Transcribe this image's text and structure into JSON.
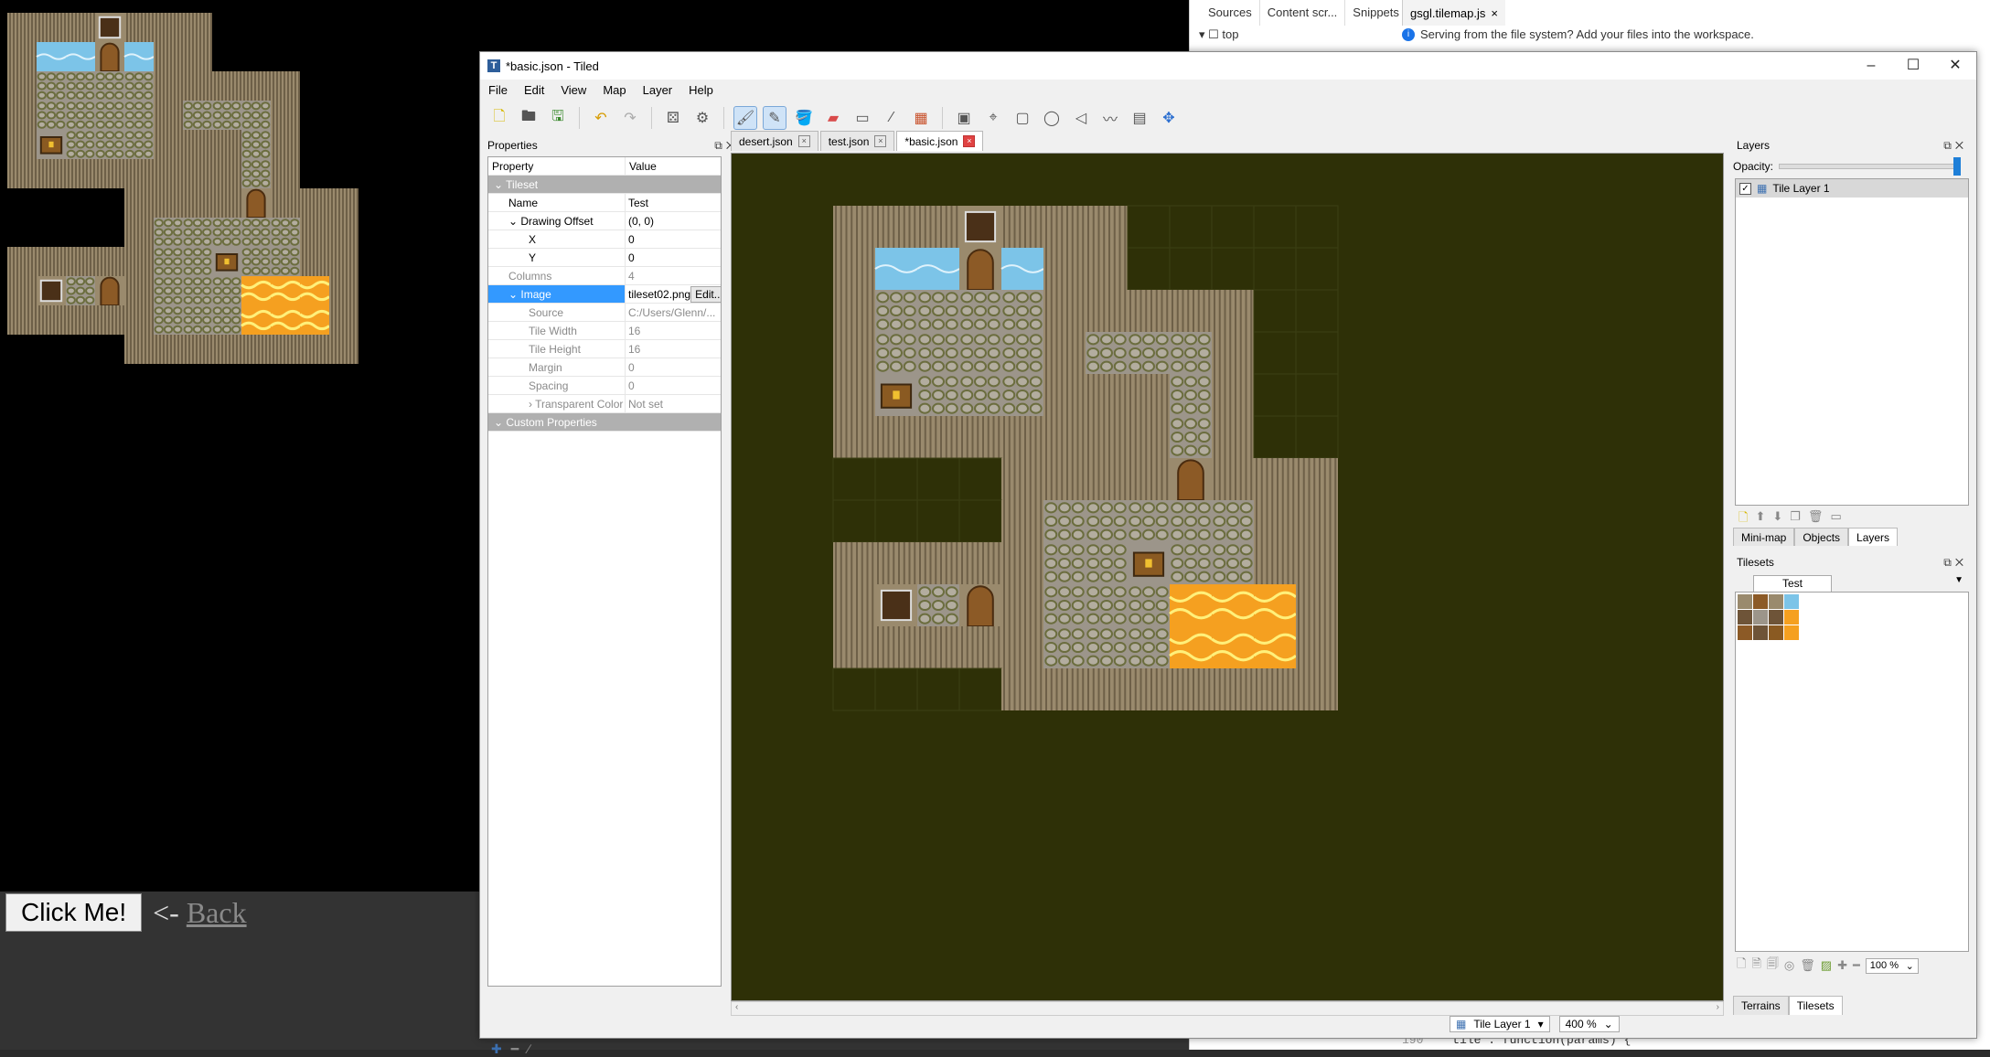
{
  "page": {
    "button_label": "Click Me!",
    "arrow_text": "<- ",
    "back_link": "Back"
  },
  "devtools": {
    "tabs": [
      "Sources",
      "Content scr...",
      "Snippets"
    ],
    "more_icon": "kebab-icon",
    "file_tab": "gsgl.tilemap.js",
    "tree_item": "top",
    "notice": "Serving from the file system? Add your files into the workspace.",
    "code_line_number": "190",
    "code_line": "tile : function(params) {"
  },
  "tiled": {
    "title": "*basic.json - Tiled",
    "menu": [
      "File",
      "Edit",
      "View",
      "Map",
      "Layer",
      "Help"
    ],
    "doc_tabs": [
      "desert.json",
      "test.json",
      "*basic.json"
    ],
    "active_doc_tab": "*basic.json",
    "properties": {
      "panel_title": "Properties",
      "col_property": "Property",
      "col_value": "Value",
      "rows": [
        {
          "type": "group",
          "key": "Tileset"
        },
        {
          "type": "row",
          "key": "Name",
          "value": "Test"
        },
        {
          "type": "row",
          "key": "Drawing Offset",
          "value": "(0, 0)",
          "expand": "v"
        },
        {
          "type": "sub",
          "key": "X",
          "value": "0"
        },
        {
          "type": "sub",
          "key": "Y",
          "value": "0"
        },
        {
          "type": "dim",
          "key": "Columns",
          "value": "4"
        },
        {
          "type": "sel",
          "key": "Image",
          "value": "tileset02.png",
          "expand": "v",
          "button": "Edit..."
        },
        {
          "type": "subdim",
          "key": "Source",
          "value": "C:/Users/Glenn/..."
        },
        {
          "type": "subdim",
          "key": "Tile Width",
          "value": "16"
        },
        {
          "type": "subdim",
          "key": "Tile Height",
          "value": "16"
        },
        {
          "type": "subdim",
          "key": "Margin",
          "value": "0"
        },
        {
          "type": "subdim",
          "key": "Spacing",
          "value": "0"
        },
        {
          "type": "subdim",
          "key": "Transparent Color",
          "value": "Not set",
          "expand": ">"
        },
        {
          "type": "group",
          "key": "Custom Properties"
        }
      ]
    },
    "layers": {
      "panel_title": "Layers",
      "opacity_label": "Opacity:",
      "opacity": 1.0,
      "layer_name": "Tile Layer 1",
      "layer_visible": true
    },
    "dock_tabs": [
      "Mini-map",
      "Objects",
      "Layers"
    ],
    "active_dock_tab": "Layers",
    "tilesets": {
      "panel_title": "Tilesets",
      "tab": "Test",
      "zoom": "100 %"
    },
    "bottom_tabs": [
      "Terrains",
      "Tilesets"
    ],
    "active_bottom_tab": "Tilesets",
    "status": {
      "layer": "Tile Layer 1",
      "zoom": "400 %"
    },
    "map": {
      "cols": 12,
      "rows": 12,
      "grid": [
        "wwwswwx.....",
        "wppdpwx.....",
        "wccccwwwwx..",
        "wccccwcccx..",
        "wkcccwwxcx..",
        "wwwwwwwwcx..",
        "....wwwwdwwx",
        "....wcccccwx",
        "wwwwwcckccwx",
        "wscdwccclllx",
        "wwwwwccclllx",
        "....wwwwwwwx"
      ]
    }
  },
  "colors": {
    "map_bg": "#2e3007",
    "wall": "#9a8a6d",
    "cobble": "#9c958a",
    "water": "#7cc4e8",
    "lava": "#f5a020",
    "door": "#8c5a26"
  }
}
